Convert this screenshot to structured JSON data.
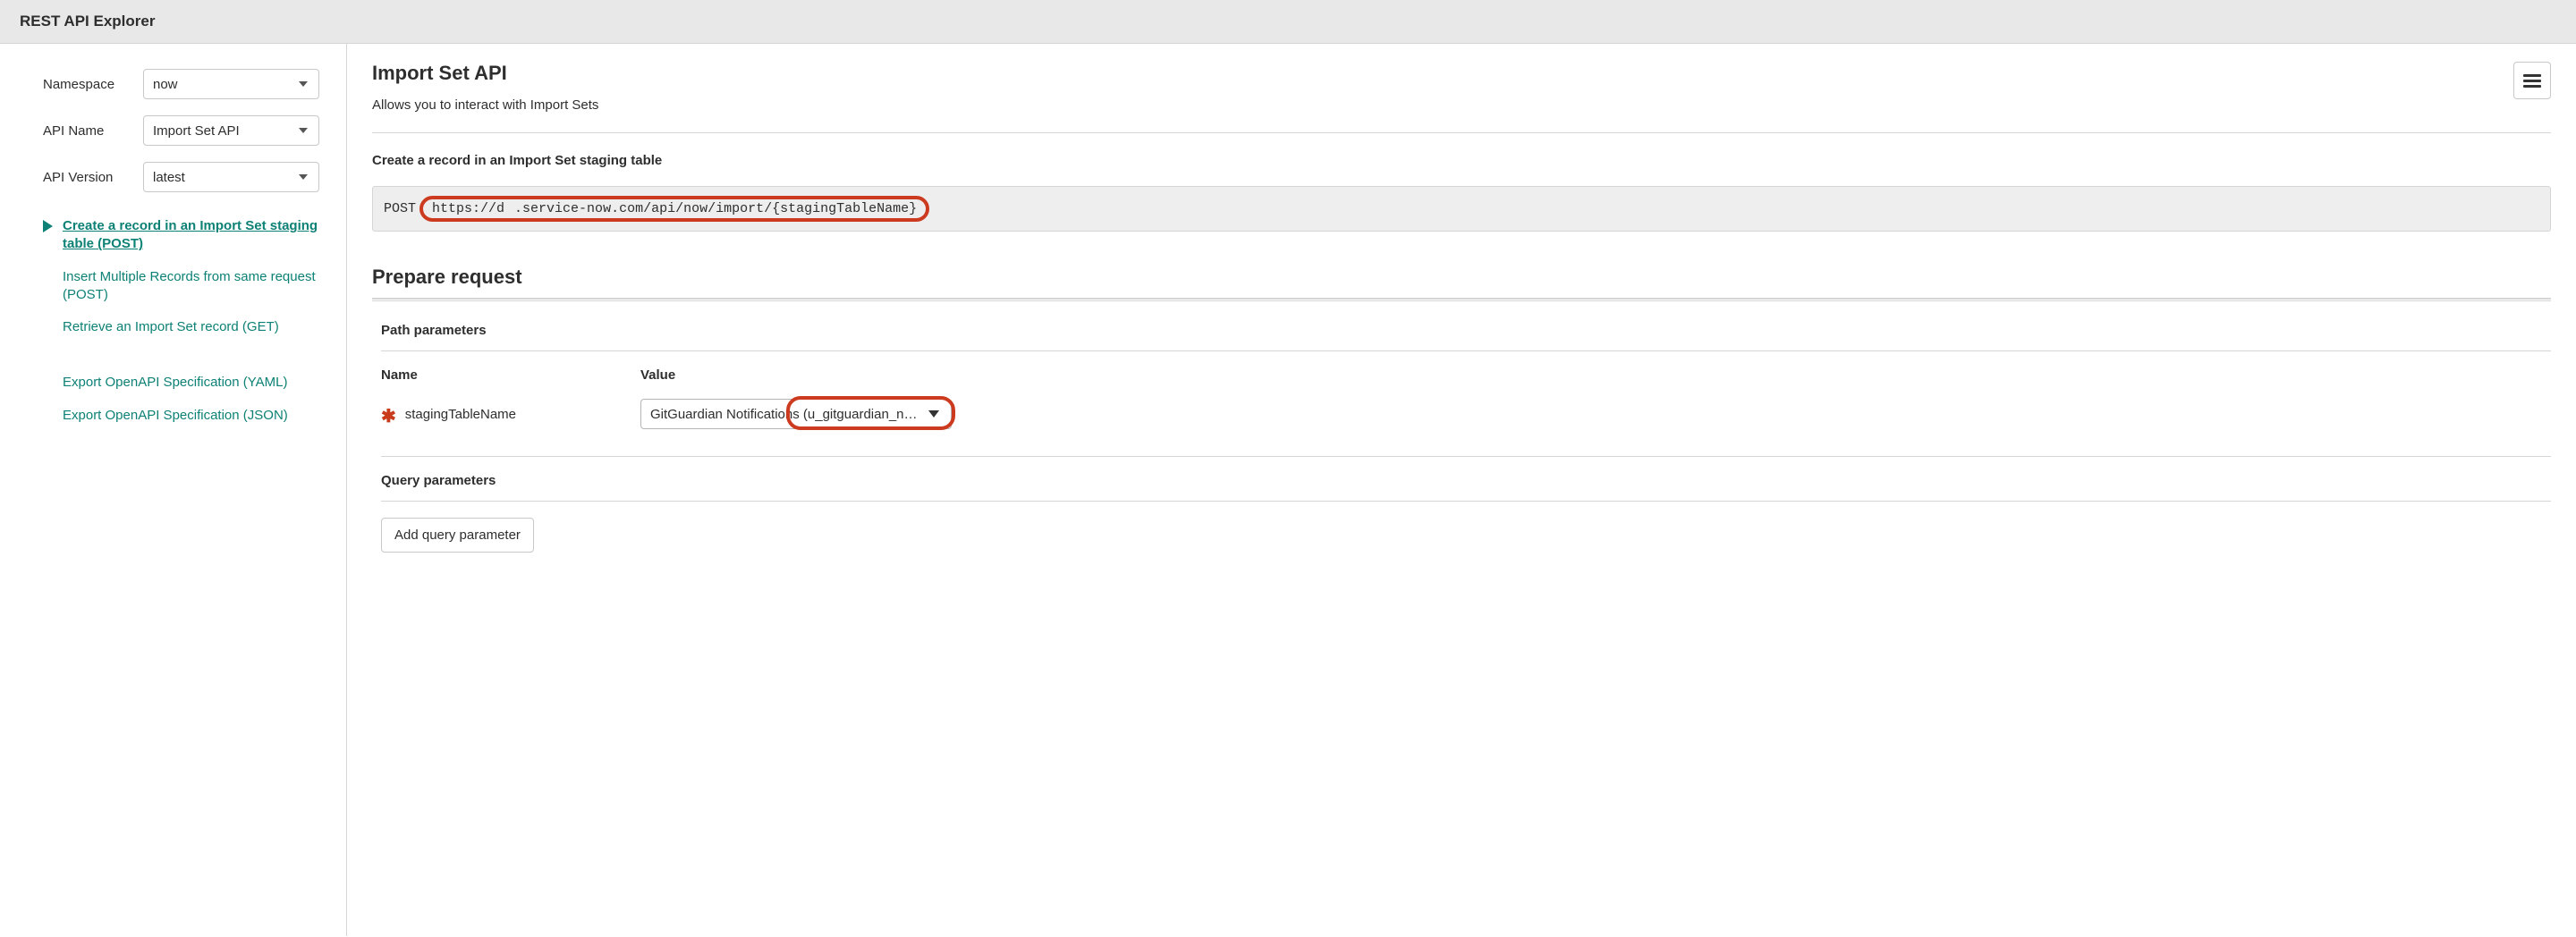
{
  "header": {
    "title": "REST API Explorer"
  },
  "sidebar": {
    "namespace_label": "Namespace",
    "namespace_value": "now",
    "api_name_label": "API Name",
    "api_name_value": "Import Set API",
    "api_version_label": "API Version",
    "api_version_value": "latest",
    "nav": [
      {
        "label": "Create a record in an Import Set staging table  (POST)",
        "active": true
      },
      {
        "label": "Insert Multiple Records from same request  (POST)",
        "active": false
      },
      {
        "label": "Retrieve an Import Set record  (GET)",
        "active": false
      }
    ],
    "export_yaml": "Export OpenAPI Specification (YAML)",
    "export_json": "Export OpenAPI Specification (JSON)"
  },
  "main": {
    "api_title": "Import Set API",
    "api_description": "Allows you to interact with Import Sets",
    "operation_label": "Create a record in an Import Set staging table",
    "endpoint_method": "POST",
    "endpoint_url_prefix": "https://d",
    "endpoint_url_suffix": ".service-now.com/api/now/import/{stagingTableName}",
    "prepare_title": "Prepare request",
    "path_params_title": "Path parameters",
    "col_name": "Name",
    "col_value": "Value",
    "param_staging_name": "stagingTableName",
    "param_staging_value": "GitGuardian Notifications (u_gitguardian_notifi…",
    "query_params_title": "Query parameters",
    "add_query_btn": "Add query parameter"
  }
}
